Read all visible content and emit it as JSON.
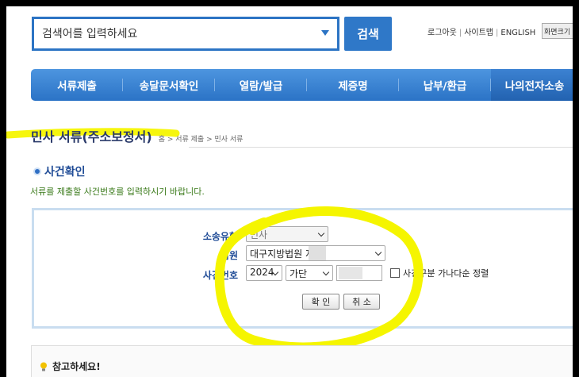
{
  "header": {
    "search_placeholder": "검색어를 입력하세요",
    "search_button": "검색",
    "links": [
      "로그아웃",
      "사이트맵",
      "ENGLISH"
    ],
    "zoom_button": "화면크기"
  },
  "nav": {
    "items": [
      "서류제출",
      "송달문서확인",
      "열람/발급",
      "제증명",
      "납부/환급",
      "나의전자소송"
    ]
  },
  "page": {
    "title": "민사 서류(주소보정서)",
    "breadcrumb": "홈 > 서류 제출 > 민사 서류"
  },
  "section": {
    "title": "사건확인",
    "instruction": "서류를 제출할 사건번호를 입력하시기 바랍니다."
  },
  "form": {
    "case_type_label": "소송유형",
    "case_type_value": "민사",
    "court_label": "법원",
    "court_value": "대구지방법원  지원",
    "case_no_label": "사건번호",
    "year_value": "2024",
    "category_value": "가단",
    "sort_checkbox_label": "사건구분 가나다순 정렬",
    "confirm_button": "확 인",
    "cancel_button": "취 소"
  },
  "notice": {
    "title": "참고하세요!"
  },
  "colors": {
    "accent": "#2f78c8",
    "highlight": "#f5f500"
  }
}
